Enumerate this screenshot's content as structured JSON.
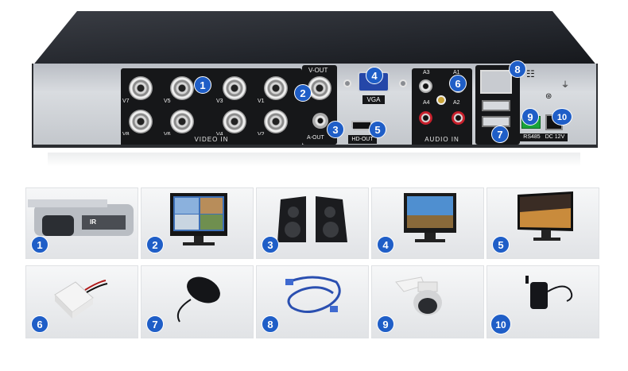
{
  "device": {
    "panels": {
      "video_in": {
        "label": "VIDEO IN",
        "ports": [
          "V7",
          "V5",
          "V3",
          "V1",
          "V8",
          "V6",
          "V4",
          "V2"
        ]
      },
      "video_out": {
        "v_out": "V-OUT",
        "a_out": "A-OUT"
      },
      "vga": {
        "label": "VGA"
      },
      "hdmi": {
        "label": "HD-OUT"
      },
      "audio_in": {
        "label": "AUDIO IN",
        "ports": [
          "A3",
          "A1",
          "A4",
          "A2"
        ]
      },
      "rs485": {
        "label": "RS485"
      },
      "power": {
        "label": "DC 12V"
      }
    },
    "callouts": [
      "1",
      "2",
      "3",
      "4",
      "5",
      "6",
      "7",
      "8",
      "9",
      "10"
    ]
  },
  "accessories": [
    {
      "number": "1",
      "item": "bullet-camera",
      "camera_text": "IR"
    },
    {
      "number": "2",
      "item": "monitor"
    },
    {
      "number": "3",
      "item": "speakers"
    },
    {
      "number": "4",
      "item": "vga-monitor"
    },
    {
      "number": "5",
      "item": "hdmi-monitor"
    },
    {
      "number": "6",
      "item": "microphone"
    },
    {
      "number": "7",
      "item": "mouse"
    },
    {
      "number": "8",
      "item": "network-cable"
    },
    {
      "number": "9",
      "item": "ptz-dome-camera"
    },
    {
      "number": "10",
      "item": "power-adapter"
    }
  ],
  "colors": {
    "badge": "#1f5ec7",
    "panel": "#161719",
    "rs485_terminal": "#1aa33a",
    "cable": "#2a4fb0"
  }
}
